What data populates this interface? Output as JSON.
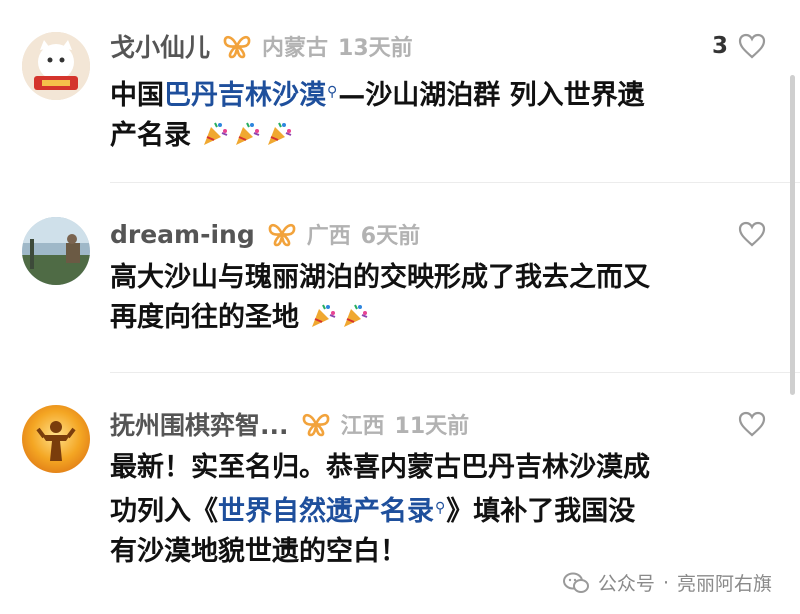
{
  "comments": [
    {
      "username": "戈小仙儿",
      "location": "内蒙古",
      "time": "13天前",
      "likes": "3",
      "line1": {
        "t1": "中国",
        "link": "巴丹吉林沙漠",
        "t2": "—沙山湖泊群 列入世界遗"
      },
      "line2": {
        "t1": "产名录"
      },
      "emoji_count": 3
    },
    {
      "username": "dream-ing",
      "location": "广西",
      "time": "6天前",
      "likes": "",
      "line1": {
        "t1": "高大沙山与瑰丽湖泊的交映形成了我去之而又"
      },
      "line2": {
        "t1": "再度向往的圣地"
      },
      "emoji_count": 2
    },
    {
      "username": "抚州围棋弈智...",
      "location": "江西",
      "time": "11天前",
      "likes": "",
      "line1": {
        "t1": "最新！实至名归。恭喜内蒙古巴丹吉林沙漠成"
      },
      "line2": {
        "t1": "功列入《",
        "link": "世界自然遗产名录",
        "t2": "》填补了我国没"
      },
      "line3": {
        "t1": "有沙漠地貌世遗的空白！"
      }
    }
  ],
  "watermark": {
    "prefix": "公众号",
    "name": "亮丽阿右旗"
  },
  "colors": {
    "link": "#1e4f9c",
    "meta": "#b2b2b2",
    "username": "#555555",
    "butterfly": "#f2a33c"
  },
  "icons": {
    "like": "heart-outline-icon",
    "badge": "butterfly-badge-icon",
    "search": "search-icon"
  }
}
